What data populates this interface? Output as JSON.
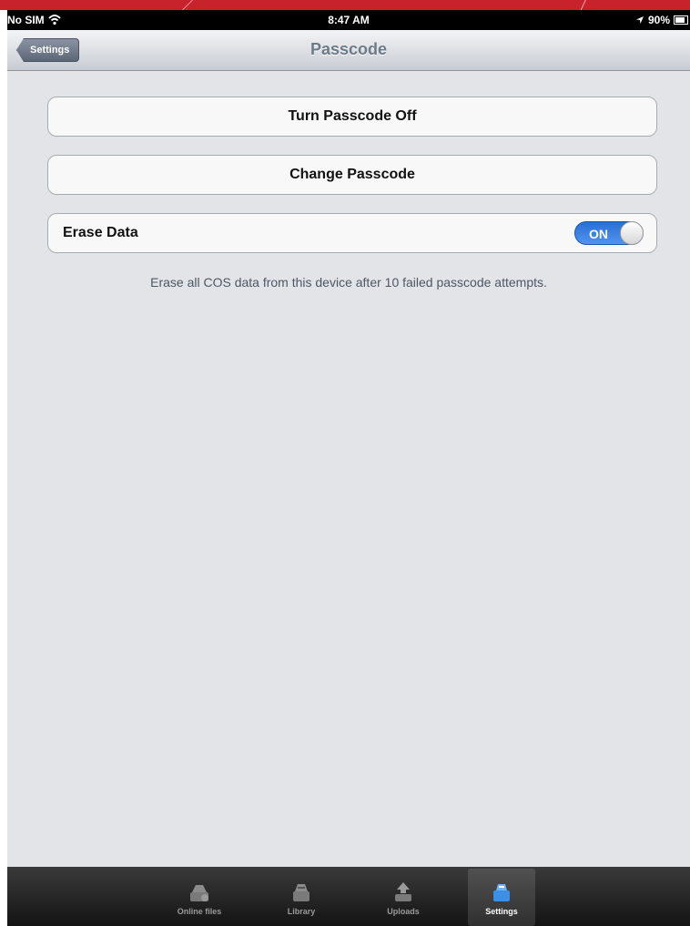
{
  "status_bar": {
    "carrier": "No SIM",
    "time": "8:47 AM",
    "battery": "90%"
  },
  "nav_bar": {
    "back_label": "Settings",
    "title": "Passcode"
  },
  "settings": {
    "turn_off_label": "Turn Passcode Off",
    "change_label": "Change Passcode",
    "erase_label": "Erase Data",
    "erase_toggle": "ON",
    "footnote": "Erase all COS data from this device after 10 failed passcode attempts."
  },
  "tab_bar": {
    "items": [
      {
        "label": "Online files",
        "icon": "online-files-icon"
      },
      {
        "label": "Library",
        "icon": "library-icon"
      },
      {
        "label": "Uploads",
        "icon": "uploads-icon"
      },
      {
        "label": "Settings",
        "icon": "settings-icon",
        "selected": true
      }
    ]
  },
  "colors": {
    "accent": "#3b82e4",
    "brand_stripe": "#c8232c"
  }
}
